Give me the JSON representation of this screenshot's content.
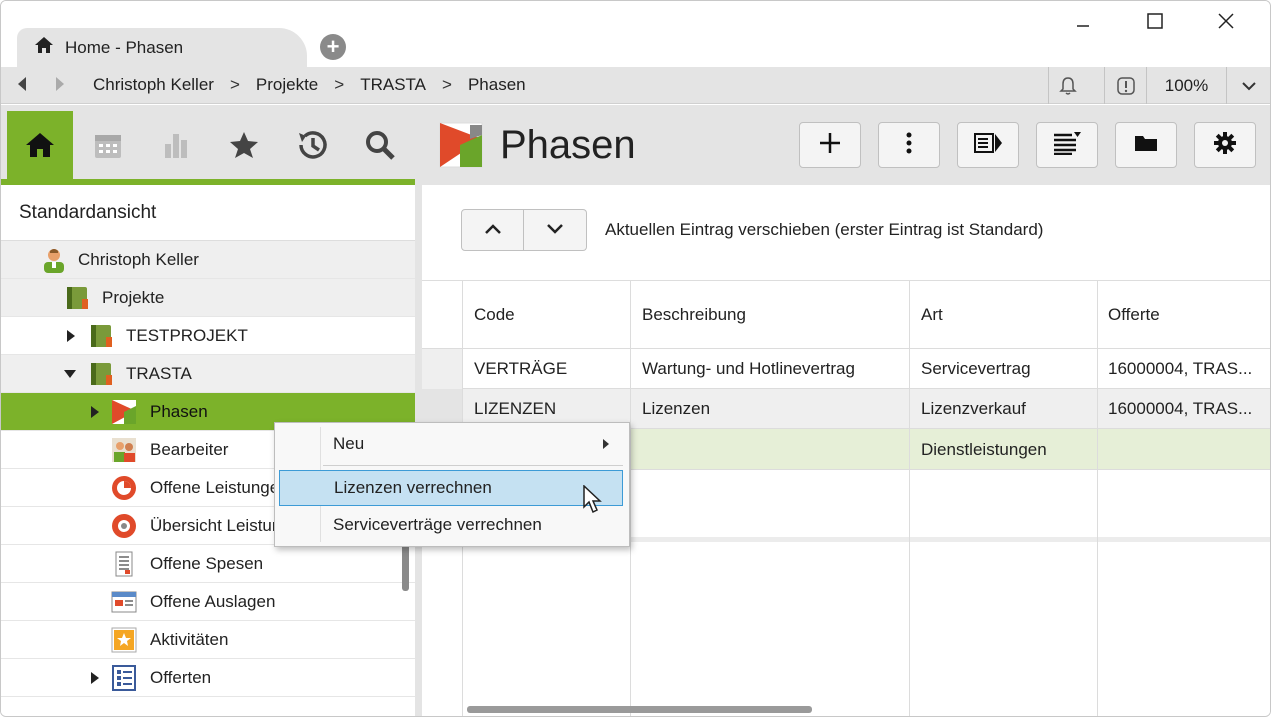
{
  "window": {
    "tab_title": "Home - Phasen",
    "tab_icon": "home-icon"
  },
  "breadcrumb": {
    "items": [
      "Christoph Keller",
      "Projekte",
      "TRASTA",
      "Phasen"
    ],
    "separator": ">",
    "zoom": "100%"
  },
  "sidebar": {
    "nav_icons": [
      "home-icon",
      "calendar-icon",
      "chart-icon",
      "star-icon",
      "history-icon",
      "search-icon"
    ],
    "view_title": "Standardansicht",
    "tree": [
      {
        "label": "Christoph Keller",
        "icon": "user-icon"
      },
      {
        "label": "Projekte",
        "icon": "project-icon"
      },
      {
        "label": "TESTPROJEKT",
        "icon": "project-icon"
      },
      {
        "label": "TRASTA",
        "icon": "project-icon"
      },
      {
        "label": "Phasen",
        "icon": "phases-icon"
      },
      {
        "label": "Bearbeiter",
        "icon": "team-icon"
      },
      {
        "label": "Offene Leistungen",
        "icon": "pie-icon"
      },
      {
        "label": "Übersicht Leistungen",
        "icon": "overview-icon"
      },
      {
        "label": "Offene Spesen",
        "icon": "receipt-icon"
      },
      {
        "label": "Offene Auslagen",
        "icon": "expenses-icon"
      },
      {
        "label": "Aktivitäten",
        "icon": "activity-icon"
      },
      {
        "label": "Offerten",
        "icon": "offer-icon"
      }
    ]
  },
  "main": {
    "title": "Phasen",
    "toolbar_icons": [
      "plus-icon",
      "more-icon",
      "details-icon",
      "sort-icon",
      "folder-icon",
      "gear-icon"
    ],
    "move_hint": "Aktuellen Eintrag verschieben (erster Eintrag ist Standard)",
    "grid": {
      "columns": [
        "Code",
        "Beschreibung",
        "Art",
        "Offerte"
      ],
      "rows": [
        [
          "VERTRÄGE",
          "Wartung- und Hotlinevertrag",
          "Servicevertrag",
          "16000004, TRAS..."
        ],
        [
          "LIZENZEN",
          "Lizenzen",
          "Lizenzverkauf",
          "16000004, TRAS..."
        ],
        [
          "",
          "",
          "Dienstleistungen",
          ""
        ]
      ]
    }
  },
  "context_menu": {
    "items": [
      "Neu",
      "Lizenzen verrechnen",
      "Serviceverträge verrechnen"
    ],
    "highlighted": "Lizenzen verrechnen"
  },
  "colors": {
    "accent_green": "#7cb22a",
    "selected_row": "#e6efd7",
    "menu_highlight": "#c5e1f2"
  }
}
